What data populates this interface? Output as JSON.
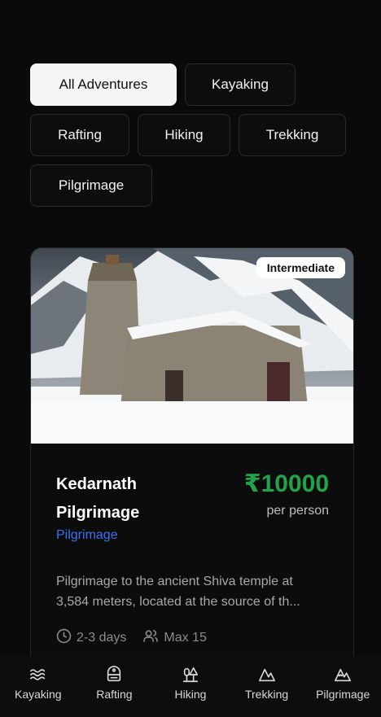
{
  "filters": [
    "All Adventures",
    "Kayaking",
    "Rafting",
    "Hiking",
    "Trekking",
    "Pilgrimage"
  ],
  "active_filter": "All Adventures",
  "card": {
    "badge": "Intermediate",
    "title": "Kedarnath Pilgrimage",
    "price": "₹10000",
    "price_unit": "per person",
    "category": "Pilgrimage",
    "description_line1": "Pilgrimage to the ancient Shiva temple at",
    "description_line2": "3,584 meters, located at the source of th...",
    "duration": "2-3 days",
    "group_size": "Max 15",
    "image_icon": "temple-photo"
  },
  "bottom_nav": [
    {
      "label": "Kayaking",
      "icon": "waves-icon"
    },
    {
      "label": "Rafting",
      "icon": "raft-icon"
    },
    {
      "label": "Hiking",
      "icon": "trees-icon"
    },
    {
      "label": "Trekking",
      "icon": "mountain-icon"
    },
    {
      "label": "Pilgrimage",
      "icon": "mountain-snow-icon"
    }
  ],
  "colors": {
    "price": "#22a34a",
    "category": "#3b6ff0",
    "background": "#0a0a0a"
  }
}
